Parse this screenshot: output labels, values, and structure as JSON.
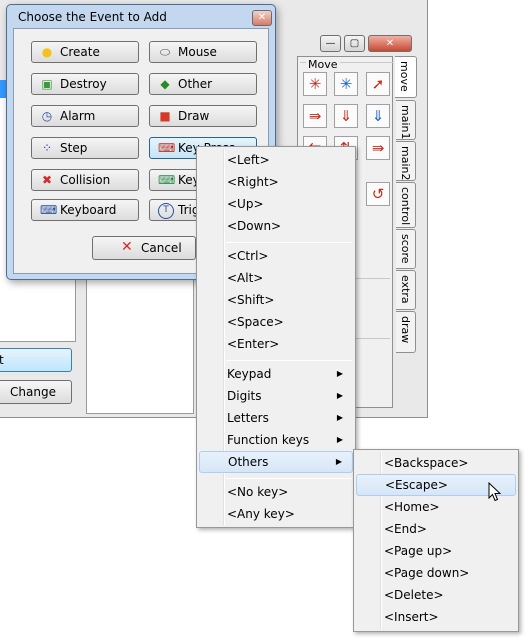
{
  "background_window": {
    "left_buttons": {
      "partial_label": "t",
      "change_label": "Change"
    },
    "title_buttons": [
      "—",
      "▢",
      "✕"
    ]
  },
  "actions": {
    "group_label": "Move",
    "tabs": [
      "move",
      "main1",
      "main2",
      "control",
      "score",
      "extra",
      "draw"
    ]
  },
  "dialog": {
    "title": "Choose the Event to Add",
    "close": "✕",
    "events": [
      {
        "label": "Create",
        "icon": "💡",
        "color": "#f2c31a"
      },
      {
        "label": "Mouse",
        "icon": "🖱",
        "color": "#555555"
      },
      {
        "label": "Destroy",
        "icon": "🗑",
        "color": "#3a9a3a"
      },
      {
        "label": "Other",
        "icon": "◆",
        "color": "#2a8a2a"
      },
      {
        "label": "Alarm",
        "icon": "⏱",
        "color": "#2a4ea0"
      },
      {
        "label": "Draw",
        "icon": "■",
        "color": "#d43a2a"
      },
      {
        "label": "Step",
        "icon": "⁘",
        "color": "#2a3ab0"
      },
      {
        "label": "Key Press",
        "icon": "⌨",
        "color": "#c42b1c"
      },
      {
        "label": "Collision",
        "icon": "✖",
        "color": "#d42a2a"
      },
      {
        "label": "Key",
        "icon": "⌨",
        "color": "#2a8a4a"
      },
      {
        "label": "Keyboard",
        "icon": "⌨",
        "color": "#2a4ea0"
      },
      {
        "label": "Trig",
        "icon": "T",
        "color": "#2a4ea0"
      }
    ],
    "cancel_label": "Cancel"
  },
  "key_menu": {
    "items": [
      "<Left>",
      "<Right>",
      "<Up>",
      "<Down>",
      "<Ctrl>",
      "<Alt>",
      "<Shift>",
      "<Space>",
      "<Enter>",
      "Keypad",
      "Digits",
      "Letters",
      "Function keys",
      "Others",
      "<No key>",
      "<Any key>"
    ],
    "highlighted": "Others"
  },
  "others_menu": {
    "items": [
      "<Backspace>",
      "<Escape>",
      "<Home>",
      "<End>",
      "<Page up>",
      "<Page down>",
      "<Delete>",
      "<Insert>"
    ],
    "highlighted": "<Escape>"
  }
}
